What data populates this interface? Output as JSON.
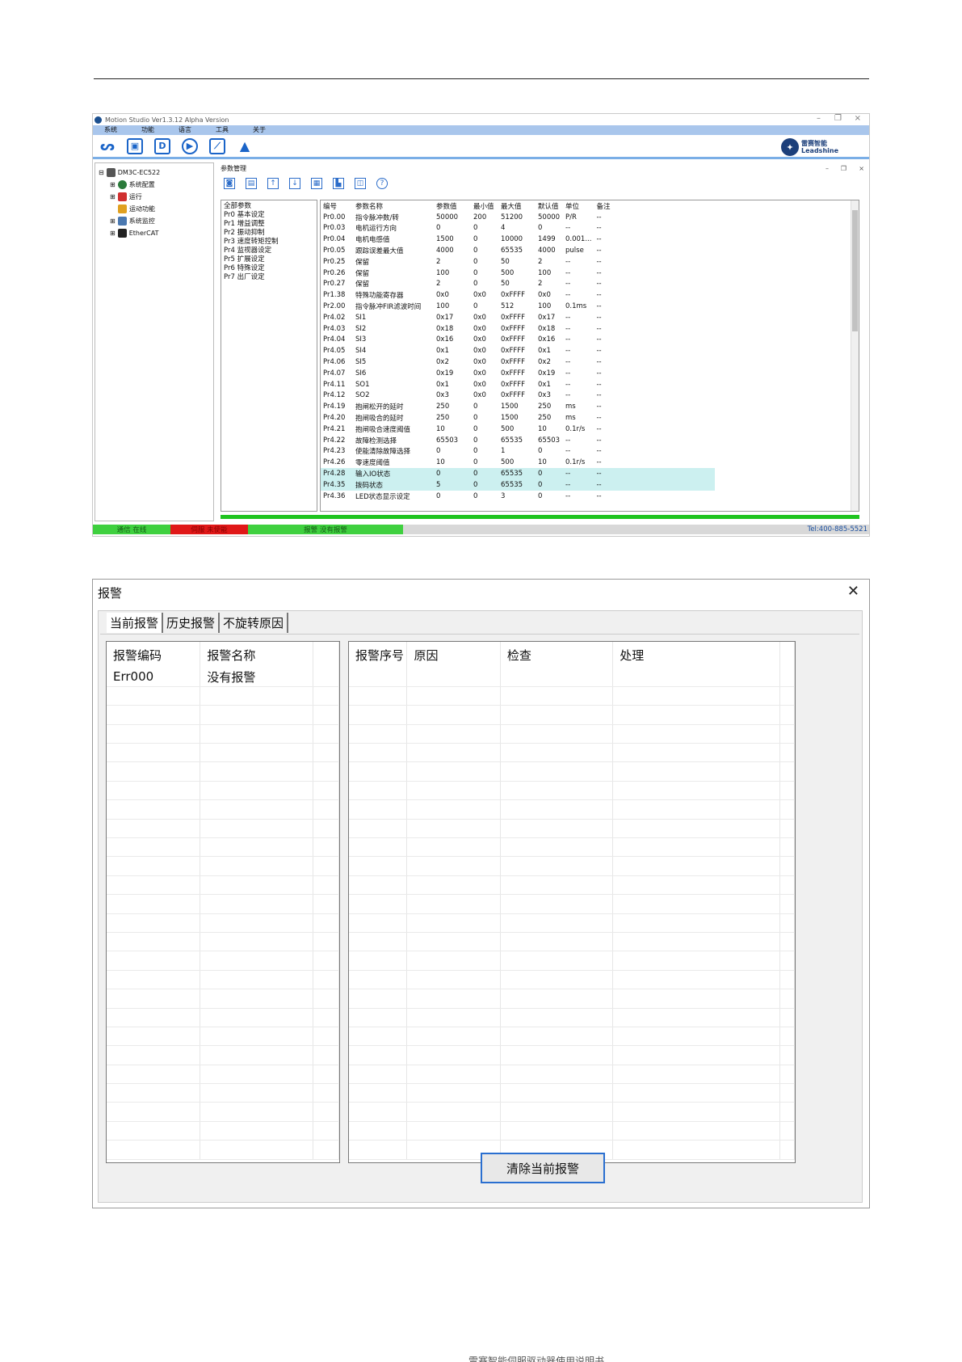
{
  "ms": {
    "title": "Motion Studio  Ver1.3.12 Alpha Version",
    "window_controls": [
      "–",
      "❐",
      "×"
    ],
    "menu": [
      "系统",
      "功能",
      "语言",
      "工具",
      "关于"
    ],
    "brand_name": "雷赛智能",
    "brand_en": "Leadshine",
    "tree": [
      "DM3C-EC522",
      "系统配置",
      "运行",
      "运动功能",
      "系统监控",
      "EtherCAT"
    ],
    "param_window_title": "参数管理",
    "groups": [
      "全部参数",
      "Pr0 基本设定",
      "Pr1 增益调整",
      "Pr2 振动抑制",
      "Pr3 速度转矩控制",
      "Pr4 监视器设定",
      "Pr5 扩展设定",
      "Pr6 特殊设定",
      "Pr7 出厂设定"
    ],
    "table_headers": [
      "编号",
      "参数名称",
      "参数值",
      "最小值",
      "最大值",
      "默认值",
      "单位",
      "备注"
    ],
    "rows": [
      [
        "Pr0.00",
        "指令脉冲数/转",
        "50000",
        "200",
        "51200",
        "50000",
        "P/R",
        "--"
      ],
      [
        "Pr0.03",
        "电机运行方向",
        "0",
        "0",
        "4",
        "0",
        "--",
        "--"
      ],
      [
        "Pr0.04",
        "电机电感值",
        "1500",
        "0",
        "10000",
        "1499",
        "0.001...",
        "--"
      ],
      [
        "Pr0.05",
        "跟踪误差最大值",
        "4000",
        "0",
        "65535",
        "4000",
        "pulse",
        "--"
      ],
      [
        "Pr0.25",
        "保留",
        "2",
        "0",
        "50",
        "2",
        "--",
        "--"
      ],
      [
        "Pr0.26",
        "保留",
        "100",
        "0",
        "500",
        "100",
        "--",
        "--"
      ],
      [
        "Pr0.27",
        "保留",
        "2",
        "0",
        "50",
        "2",
        "--",
        "--"
      ],
      [
        "Pr1.38",
        "特殊功能寄存器",
        "0x0",
        "0x0",
        "0xFFFF",
        "0x0",
        "--",
        "--"
      ],
      [
        "Pr2.00",
        "指令脉冲FIR滤波时间",
        "100",
        "0",
        "512",
        "100",
        "0.1ms",
        "--"
      ],
      [
        "Pr4.02",
        "SI1",
        "0x17",
        "0x0",
        "0xFFFF",
        "0x17",
        "--",
        "--"
      ],
      [
        "Pr4.03",
        "SI2",
        "0x18",
        "0x0",
        "0xFFFF",
        "0x18",
        "--",
        "--"
      ],
      [
        "Pr4.04",
        "SI3",
        "0x16",
        "0x0",
        "0xFFFF",
        "0x16",
        "--",
        "--"
      ],
      [
        "Pr4.05",
        "SI4",
        "0x1",
        "0x0",
        "0xFFFF",
        "0x1",
        "--",
        "--"
      ],
      [
        "Pr4.06",
        "SI5",
        "0x2",
        "0x0",
        "0xFFFF",
        "0x2",
        "--",
        "--"
      ],
      [
        "Pr4.07",
        "SI6",
        "0x19",
        "0x0",
        "0xFFFF",
        "0x19",
        "--",
        "--"
      ],
      [
        "Pr4.11",
        "SO1",
        "0x1",
        "0x0",
        "0xFFFF",
        "0x1",
        "--",
        "--"
      ],
      [
        "Pr4.12",
        "SO2",
        "0x3",
        "0x0",
        "0xFFFF",
        "0x3",
        "--",
        "--"
      ],
      [
        "Pr4.19",
        "抱闸松开的延时",
        "250",
        "0",
        "1500",
        "250",
        "ms",
        "--"
      ],
      [
        "Pr4.20",
        "抱闸吸合的延时",
        "250",
        "0",
        "1500",
        "250",
        "ms",
        "--"
      ],
      [
        "Pr4.21",
        "抱闸吸合速度阈值",
        "10",
        "0",
        "500",
        "10",
        "0.1r/s",
        "--"
      ],
      [
        "Pr4.22",
        "故障检测选择",
        "65503",
        "0",
        "65535",
        "65503",
        "--",
        "--"
      ],
      [
        "Pr4.23",
        "使能清除故障选择",
        "0",
        "0",
        "1",
        "0",
        "--",
        "--"
      ],
      [
        "Pr4.26",
        "零速度阈值",
        "10",
        "0",
        "500",
        "10",
        "0.1r/s",
        "--"
      ],
      [
        "Pr4.28",
        "输入IO状态",
        "0",
        "0",
        "65535",
        "0",
        "--",
        "--"
      ],
      [
        "Pr4.35",
        "拨码状态",
        "5",
        "0",
        "65535",
        "0",
        "--",
        "--"
      ],
      [
        "Pr4.36",
        "LED状态显示设定",
        "0",
        "0",
        "3",
        "0",
        "--",
        "--"
      ]
    ],
    "highlight_rows": [
      23,
      24
    ],
    "status": {
      "comm": "通信 在线",
      "run": "伺服 未使能",
      "alarm": "报警 没有报警",
      "tel": "Tel:400-885-5521"
    },
    "colors": {
      "menu_bar": "#a9c6ec",
      "status_green": "#3fd03f",
      "status_red": "#e01818",
      "highlight": "#ccf0f0"
    }
  },
  "alarm": {
    "title": "报警",
    "close": "✕",
    "tabs": [
      "当前报警",
      "历史报警",
      "不旋转原因"
    ],
    "left_headers": [
      "报警编码",
      "报警名称"
    ],
    "left_rows": [
      [
        "Err000",
        "没有报警"
      ]
    ],
    "right_headers": [
      "报警序号",
      "原因",
      "检查",
      "处理"
    ],
    "clear_button": "清除当前报警"
  },
  "footer_text": "雷赛智能伺服驱动器使用说明书"
}
